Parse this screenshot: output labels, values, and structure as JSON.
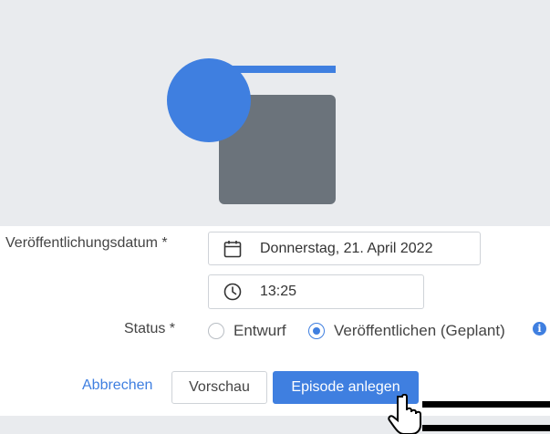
{
  "form": {
    "date_label": "Veröffentlichungsdatum *",
    "date_value": "Donnerstag, 21. April 2022",
    "time_value": "13:25",
    "status_label": "Status *",
    "status_options": [
      {
        "label": "Entwurf",
        "selected": false
      },
      {
        "label": "Veröffentlichen (Geplant)",
        "selected": true
      }
    ]
  },
  "actions": {
    "cancel_label": "Abbrechen",
    "preview_label": "Vorschau",
    "create_label": "Episode anlegen"
  },
  "icons": {
    "date": "calendar-icon",
    "time": "clock-icon",
    "info": "info-icon",
    "cursor": "hand-pointer-icon"
  },
  "colors": {
    "accent": "#3f7fe0",
    "illustration_circle": "#3f7fe0",
    "illustration_square": "#6b737b",
    "background": "#e9ebee"
  }
}
